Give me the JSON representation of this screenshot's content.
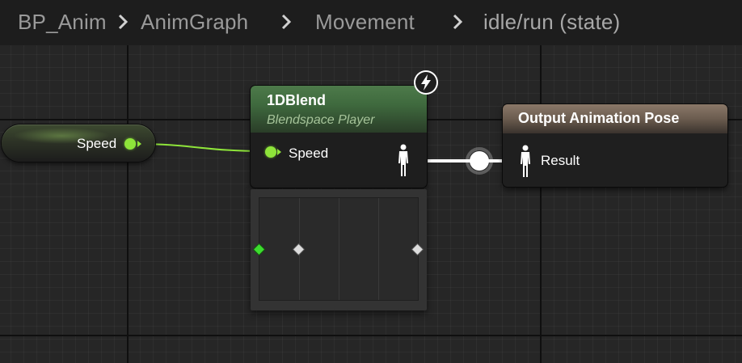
{
  "breadcrumb": {
    "items": [
      "BP_Anim",
      "AnimGraph",
      "Movement",
      "idle/run (state)"
    ],
    "separator_icon": "chevron-right-icon"
  },
  "variable_node": {
    "label": "Speed",
    "pin_color": "#8ee43a"
  },
  "blendspace_node": {
    "title": "1DBlend",
    "subtitle": "Blendspace Player",
    "input_pin_label": "Speed",
    "header_color": "#4d7a4a",
    "badge_icon": "lightning-icon",
    "output_pin_icon": "pose-figure-icon"
  },
  "blend_preview": {
    "sample_point_icons": [
      "diamond-green-icon",
      "diamond-white-icon",
      "diamond-white-icon"
    ]
  },
  "output_node": {
    "title": "Output Animation Pose",
    "input_pin_label": "Result",
    "header_color": "#8a7868",
    "input_pin_icon": "pose-figure-icon"
  },
  "colors": {
    "graph_background": "#262626",
    "float_wire": "#8ee43a",
    "pose_wire": "#ffffff"
  }
}
